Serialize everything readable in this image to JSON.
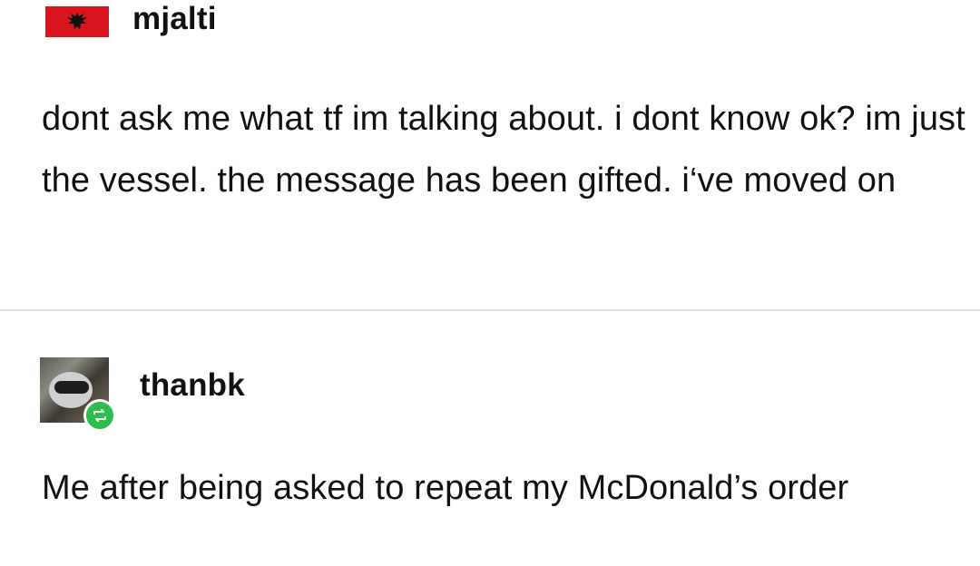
{
  "posts": [
    {
      "username": "mjalti",
      "avatar_icon": "albania-flag-icon",
      "body": "dont ask me what tf im talking about. i dont know ok? im just the vessel. the message has been gifted. i‘ve moved on"
    },
    {
      "username": "thanbk",
      "avatar_icon": "raccoon-avatar-icon",
      "badge_icon": "reblog-icon",
      "body": "Me after being asked to repeat my McDonald’s order"
    }
  ],
  "colors": {
    "flag_red": "#d8141e",
    "reblog_green": "#2ebd4e",
    "divider": "#dddddd",
    "text": "#111111"
  }
}
